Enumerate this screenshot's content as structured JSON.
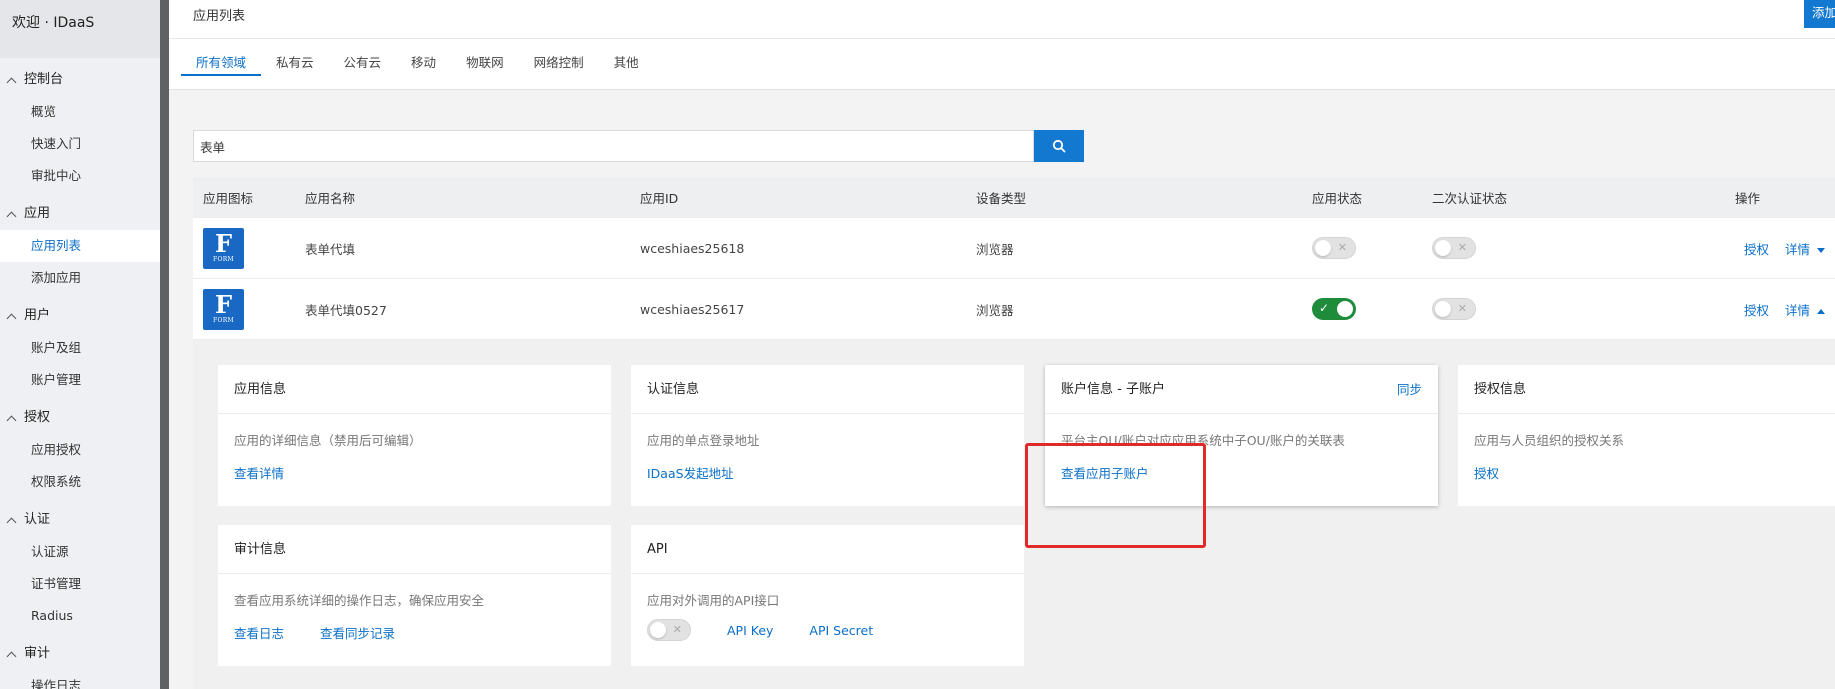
{
  "sidebar": {
    "header": "欢迎 · IDaaS",
    "groups": [
      {
        "label": "控制台",
        "items": [
          "概览",
          "快速入门",
          "审批中心"
        ]
      },
      {
        "label": "应用",
        "items": [
          "应用列表",
          "添加应用"
        ]
      },
      {
        "label": "用户",
        "items": [
          "账户及组",
          "账户管理"
        ]
      },
      {
        "label": "授权",
        "items": [
          "应用授权",
          "权限系统"
        ]
      },
      {
        "label": "认证",
        "items": [
          "认证源",
          "证书管理",
          "Radius"
        ]
      },
      {
        "label": "审计",
        "items": [
          "操作日志"
        ]
      }
    ],
    "active_item": "应用列表"
  },
  "header": {
    "title": "应用列表",
    "add_button": "添加"
  },
  "tabs": [
    "所有领域",
    "私有云",
    "公有云",
    "移动",
    "物联网",
    "网络控制",
    "其他"
  ],
  "search": {
    "value": "表单"
  },
  "table": {
    "columns": [
      "应用图标",
      "应用名称",
      "应用ID",
      "设备类型",
      "应用状态",
      "二次认证状态",
      "操作"
    ],
    "rows": [
      {
        "icon_letter": "F",
        "icon_sub": "FORM",
        "name": "表单代填",
        "id": "wceshiaes25618",
        "device": "浏览器",
        "app_status": false,
        "mfa_status": false,
        "op_auth": "授权",
        "op_detail": "详情"
      },
      {
        "icon_letter": "F",
        "icon_sub": "FORM",
        "name": "表单代填0527",
        "id": "wceshiaes25617",
        "device": "浏览器",
        "app_status": true,
        "mfa_status": false,
        "op_auth": "授权",
        "op_detail": "详情"
      }
    ]
  },
  "cards": {
    "app_info": {
      "title": "应用信息",
      "desc": "应用的详细信息（禁用后可编辑）",
      "link": "查看详情"
    },
    "auth_info": {
      "title": "认证信息",
      "desc": "应用的单点登录地址",
      "link": "IDaaS发起地址"
    },
    "account_info": {
      "title": "账户信息 - 子账户",
      "action": "同步",
      "desc": "平台主OU/账户对应应用系统中子OU/账户的关联表",
      "link": "查看应用子账户"
    },
    "grant_info": {
      "title": "授权信息",
      "desc": "应用与人员组织的授权关系",
      "link": "授权"
    },
    "audit_info": {
      "title": "审计信息",
      "desc": "查看应用系统详细的操作日志，确保应用安全",
      "link1": "查看日志",
      "link2": "查看同步记录"
    },
    "api": {
      "title": "API",
      "desc": "应用对外调用的API接口",
      "link1": "API Key",
      "link2": "API Secret",
      "toggle": false
    }
  },
  "colors": {
    "accent": "#1378d0",
    "toggle_on": "#1f8c3c",
    "highlight": "#e02a2a"
  }
}
